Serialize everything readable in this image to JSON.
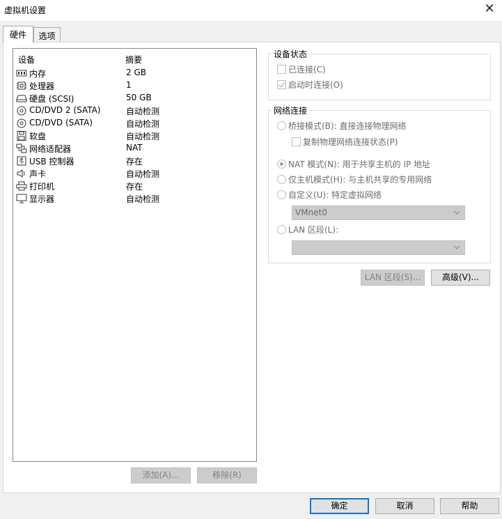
{
  "window": {
    "title": "虚拟机设置"
  },
  "tabs": [
    {
      "label": "硬件",
      "active": true
    },
    {
      "label": "选项",
      "active": false
    }
  ],
  "device_list": {
    "columns": [
      "设备",
      "摘要"
    ],
    "rows": [
      {
        "icon": "memory-icon",
        "name": "内存",
        "summary": "2 GB"
      },
      {
        "icon": "cpu-icon",
        "name": "处理器",
        "summary": "1"
      },
      {
        "icon": "hard-disk-icon",
        "name": "硬盘 (SCSI)",
        "summary": "50 GB"
      },
      {
        "icon": "cd-dvd-icon",
        "name": "CD/DVD 2 (SATA)",
        "summary": "自动检测"
      },
      {
        "icon": "cd-dvd-icon",
        "name": "CD/DVD (SATA)",
        "summary": "自动检测"
      },
      {
        "icon": "floppy-icon",
        "name": "软盘",
        "summary": "自动检测"
      },
      {
        "icon": "network-adapter-icon",
        "name": "网络适配器",
        "summary": "NAT"
      },
      {
        "icon": "usb-icon",
        "name": "USB 控制器",
        "summary": "存在"
      },
      {
        "icon": "speaker-icon",
        "name": "声卡",
        "summary": "自动检测"
      },
      {
        "icon": "printer-icon",
        "name": "打印机",
        "summary": "存在"
      },
      {
        "icon": "monitor-icon",
        "name": "显示器",
        "summary": "自动检测"
      }
    ],
    "add_button": "添加(A)...",
    "remove_button": "移除(R)"
  },
  "device_status": {
    "title": "设备状态",
    "connected": {
      "label": "已连接(C)",
      "checked": false
    },
    "connect_at_power_on": {
      "label": "启动时连接(O)",
      "checked": true
    }
  },
  "network": {
    "title": "网络连接",
    "bridged": {
      "label": "桥接模式(B): 直接连接物理网络",
      "selected": false
    },
    "replicate": {
      "label": "复制物理网络连接状态(P)",
      "checked": false
    },
    "nat": {
      "label": "NAT 模式(N): 用于共享主机的 IP 地址",
      "selected": true
    },
    "host_only": {
      "label": "仅主机模式(H): 与主机共享的专用网络",
      "selected": false
    },
    "custom": {
      "label": "自定义(U): 特定虚拟网络",
      "selected": false
    },
    "custom_select_value": "VMnet0",
    "lan_segment": {
      "label": "LAN 区段(L):",
      "selected": false
    },
    "lan_select_value": "",
    "lan_segments_button": "LAN 区段(S)...",
    "advanced_button": "高级(V)..."
  },
  "dialog_buttons": {
    "ok": "确定",
    "cancel": "取消",
    "help": "帮助"
  }
}
